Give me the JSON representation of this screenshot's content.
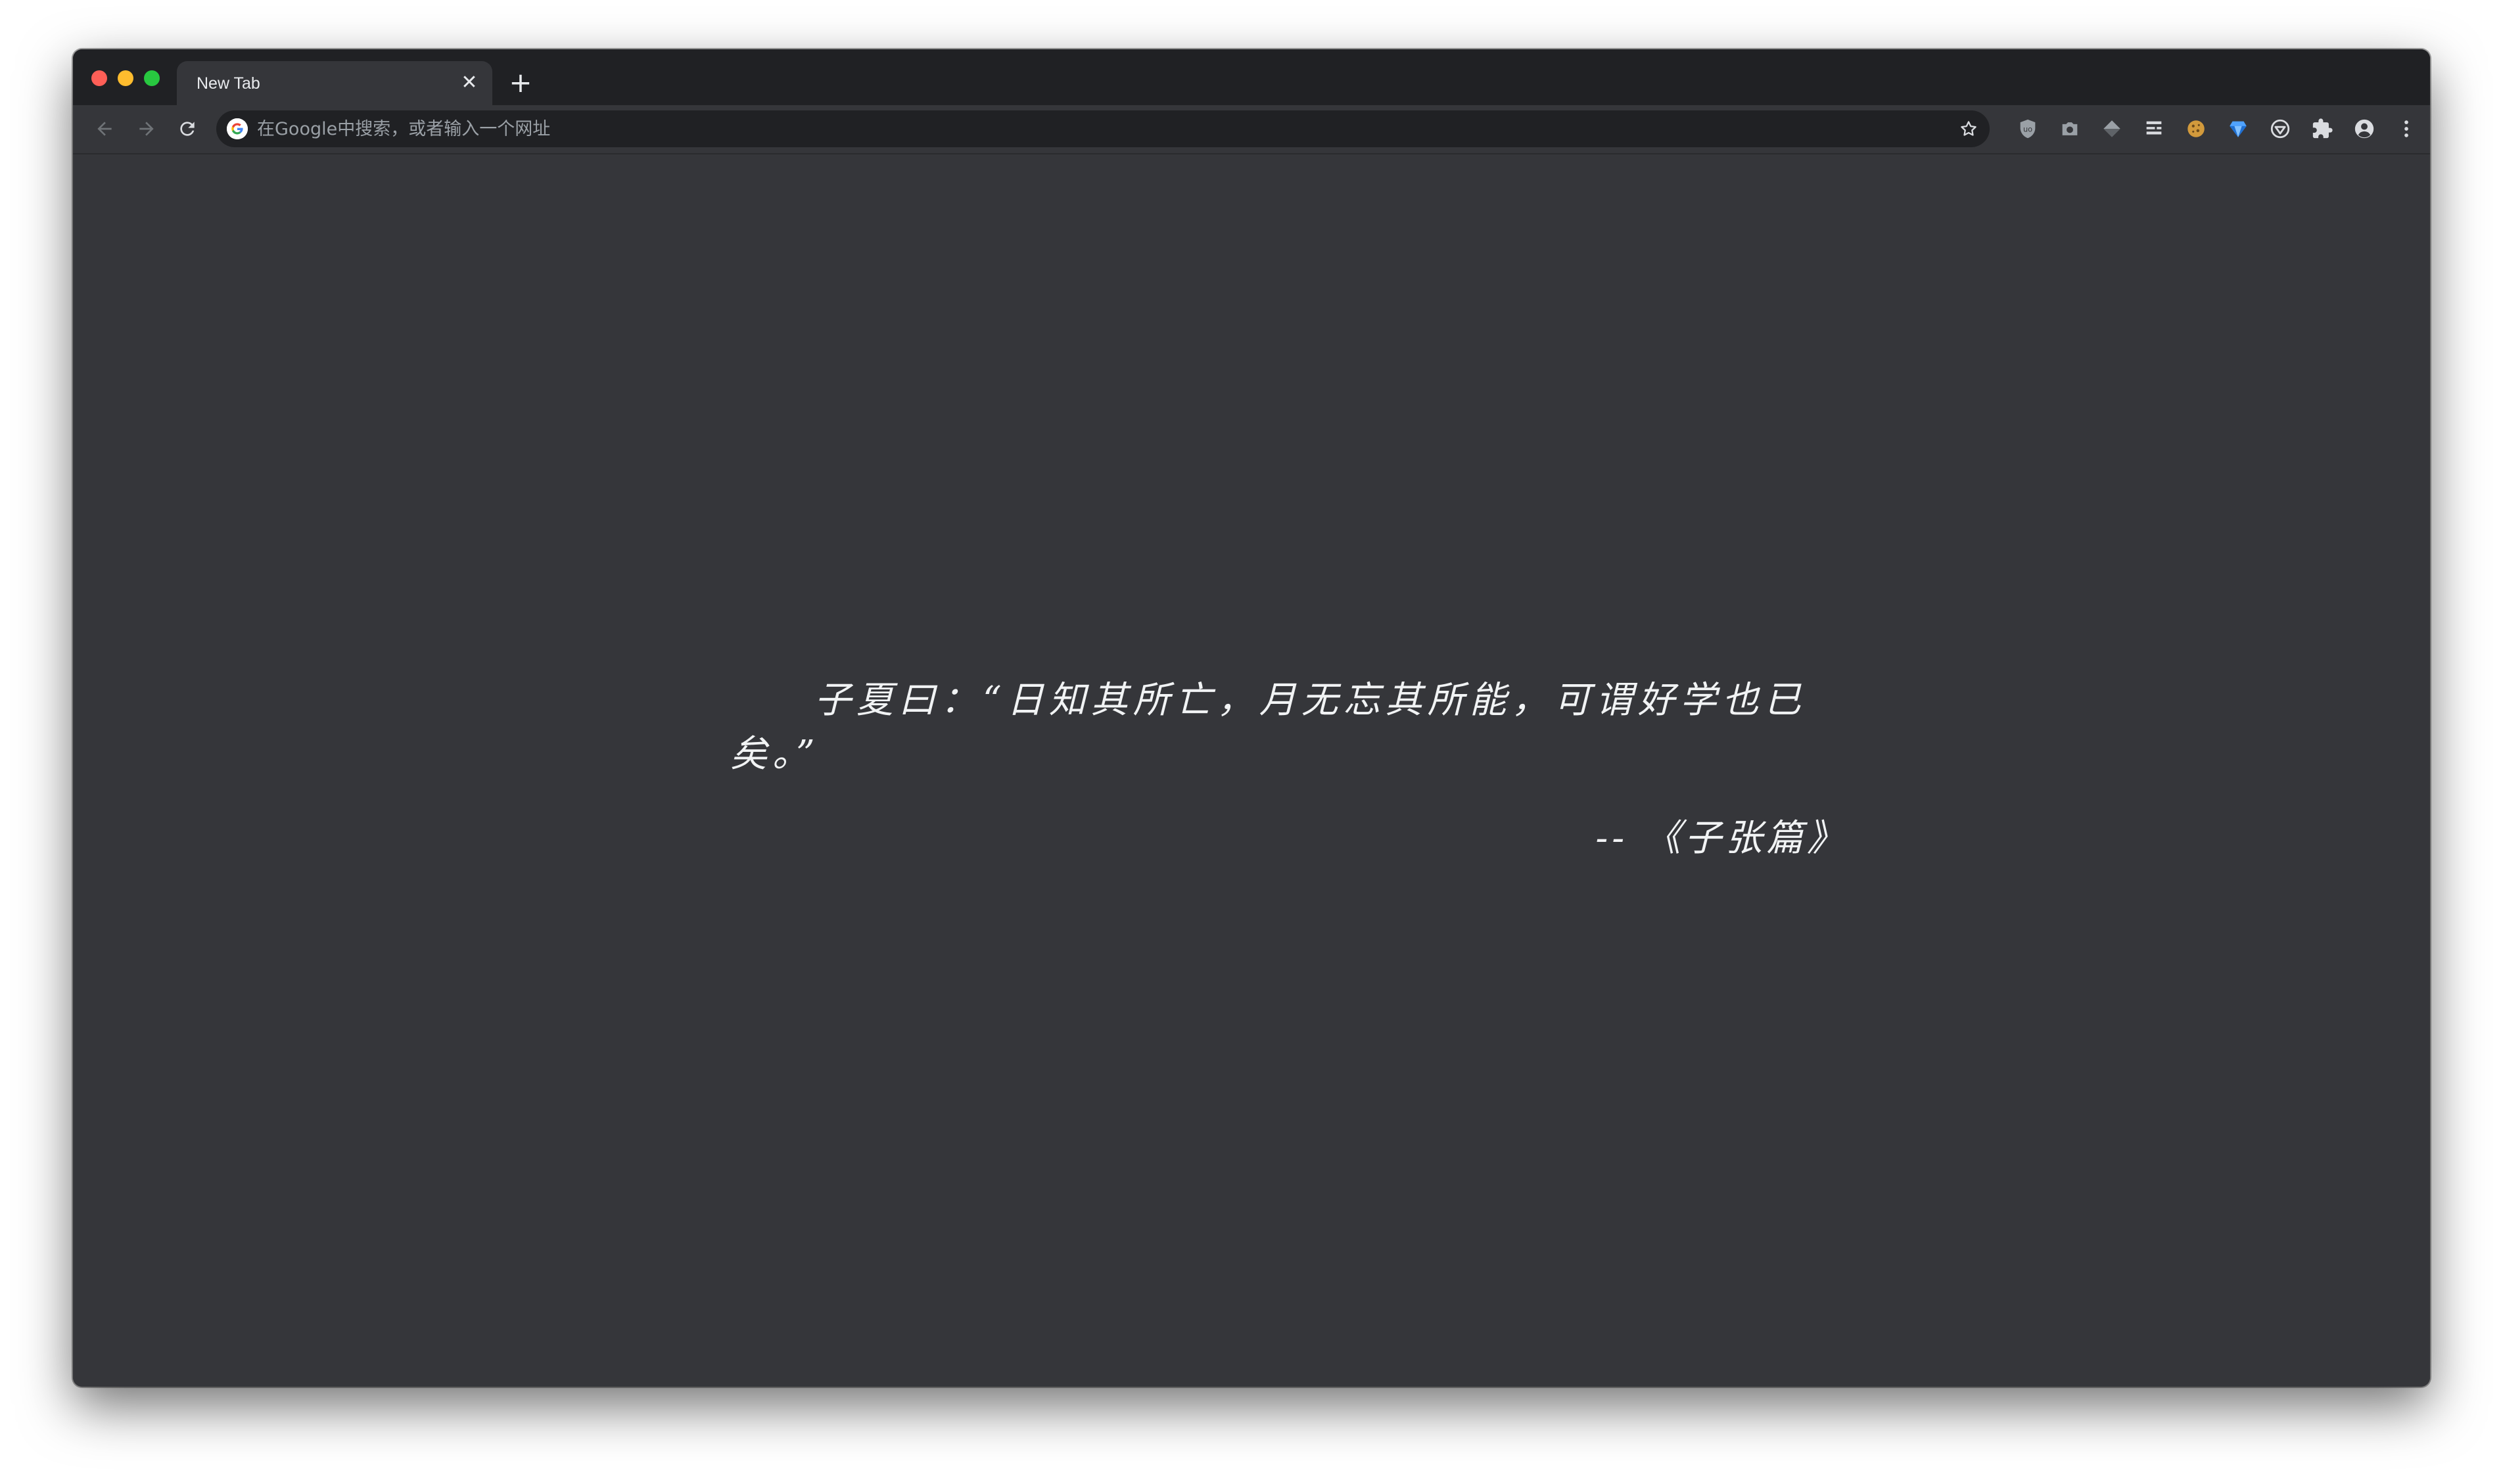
{
  "window": {
    "controls": [
      "close",
      "minimize",
      "zoom"
    ]
  },
  "tab": {
    "title": "New Tab",
    "close_glyph": "✕",
    "new_tab_glyph": "+"
  },
  "toolbar": {
    "back_icon": "arrow-left-icon",
    "forward_icon": "arrow-right-icon",
    "reload_icon": "reload-icon",
    "omnibox_placeholder": "在Google中搜索，或者输入一个网址",
    "bookmark_icon": "star-icon",
    "extensions": [
      "shield-extension-icon",
      "camera-extension-icon",
      "layers-extension-icon",
      "reader-extension-icon",
      "cookie-extension-icon",
      "gem-extension-icon",
      "vpn-extension-icon",
      "puzzle-extensions-icon",
      "profile-icon",
      "kebab-menu-icon"
    ]
  },
  "content": {
    "quote": "子夏曰：“日知其所亡，月无忘其所能，可谓好学也已矣。”",
    "attribution": "-- 《子张篇》"
  },
  "colors": {
    "titlebar": "#202124",
    "toolbar": "#35363a",
    "omnibox": "#202124",
    "content_bg": "#35363a",
    "text": "#f1f3f4",
    "icon": "#9aa0a6"
  }
}
